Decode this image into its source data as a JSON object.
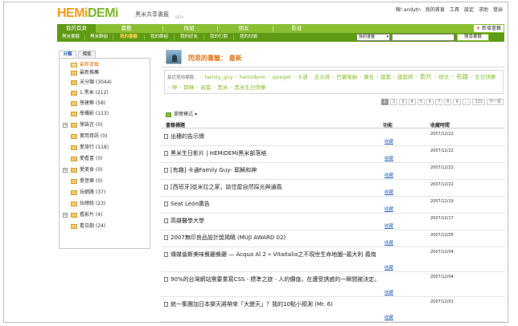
{
  "header": {
    "logo": "HEMiDEMi",
    "subtitle": "黑米共享書籤",
    "beta": "BETA",
    "user_links": [
      "嗨! andytn",
      "我的首頁",
      "工具",
      "設定",
      "求助",
      "登出"
    ]
  },
  "main_nav": {
    "tabs": [
      "我的首頁",
      "書籤",
      "群組",
      "朋友",
      "影音"
    ],
    "new_bookmark": "新增書籤"
  },
  "sub_nav": {
    "items": [
      "黑米書籤",
      "黑米群組",
      "我的書籤",
      "我的群組",
      "我的好友",
      "我的訂閱",
      "我的討論"
    ],
    "search_select": "我的書籤",
    "search_placeholder": "",
    "search_button": "搜尋書籤"
  },
  "sidebar": {
    "tabs": [
      "分類",
      "標籤"
    ],
    "items": [
      {
        "label": "最新書籤",
        "expander": false,
        "active": true
      },
      {
        "label": "最新推薦",
        "expander": false,
        "active": false
      },
      {
        "label": "未分類 (3044)",
        "expander": false,
        "active": false
      },
      {
        "label": "1.黑米 (212)",
        "expander": false,
        "active": false
      },
      {
        "label": "學建築 (58)",
        "expander": false,
        "active": false
      },
      {
        "label": "學攝影 (113)",
        "expander": false,
        "active": false
      },
      {
        "label": "學語言 (0)",
        "expander": true,
        "active": false
      },
      {
        "label": "實用資訊 (0)",
        "expander": false,
        "active": false
      },
      {
        "label": "愛旅行 (118)",
        "expander": false,
        "active": false
      },
      {
        "label": "愛看書 (0)",
        "expander": false,
        "active": false
      },
      {
        "label": "愛美食 (0)",
        "expander": true,
        "active": false
      },
      {
        "label": "愛音樂 (0)",
        "expander": false,
        "active": false
      },
      {
        "label": "玩網路 (37)",
        "expander": false,
        "active": false
      },
      {
        "label": "玩總統 (23)",
        "expander": false,
        "active": false
      },
      {
        "label": "看影片 (4)",
        "expander": true,
        "active": false
      },
      {
        "label": "看日劇 (24)",
        "expander": false,
        "active": false
      }
    ]
  },
  "content": {
    "title": "閃思的書籤： 最新",
    "tags_label": "最近使用標籤：",
    "tags": [
      {
        "text": "family_guy",
        "big": false
      },
      {
        "text": "hemidemi",
        "big": false
      },
      {
        "text": "spiegel",
        "big": false
      },
      {
        "text": "卡通",
        "big": false
      },
      {
        "text": "吉示排",
        "big": false
      },
      {
        "text": "巴塞隆納",
        "big": false
      },
      {
        "text": "廣告",
        "big": false
      },
      {
        "text": "建築",
        "big": false
      },
      {
        "text": "建築師",
        "big": false
      },
      {
        "text": "影片",
        "big": true
      },
      {
        "text": "德文",
        "big": false
      },
      {
        "text": "有趣",
        "big": true
      },
      {
        "text": "生日快樂",
        "big": false
      },
      {
        "text": "神",
        "big": false
      },
      {
        "text": "耶穌",
        "big": false
      },
      {
        "text": "高築",
        "big": false
      },
      {
        "text": "黑米",
        "big": false
      },
      {
        "text": "黑米生日快樂",
        "big": false
      }
    ],
    "pager": [
      "1",
      "2",
      "3",
      "4",
      "5",
      "6",
      "7",
      "8",
      "9",
      "...",
      "123",
      "下一頁"
    ],
    "pager_active": 0,
    "view_mode": "瀏覽模式",
    "columns": {
      "title": "書籤標題",
      "function": "功能",
      "date": "收藏時間"
    },
    "rows": [
      {
        "title": "出穗的告示牌",
        "func": "收藏",
        "date": "2007/12/22"
      },
      {
        "title": "黑米生日影片 | HEMiDEMi黑米部落格",
        "func": "收藏",
        "date": "2007/12/22"
      },
      {
        "title": "[有趣] 卡通Family Guy- 耶穌和神",
        "func": "收藏",
        "date": "2007/12/22"
      },
      {
        "title": "[西班牙]從米拉之家，談住屋自然採光與通風",
        "func": "收藏",
        "date": "2007/12/22"
      },
      {
        "title": "Seat León廣告",
        "func": "收藏",
        "date": "2007/12/19"
      },
      {
        "title": "高雄醫學大學",
        "func": "收藏",
        "date": "2007/12/17"
      },
      {
        "title": "2007無印良品設計獎揭曉 (MUJI AWARD 02)",
        "func": "收藏",
        "date": "2007/12/05"
      },
      {
        "title": "傳媒倫斯美味餐廳餐廳 — Acqua Al 2 « Vitaitalia之不現世生命地圖─義大利 義南",
        "func": "收藏",
        "date": "2007/12/04"
      },
      {
        "title": "90%的台灣網站需要重寫CSS - 標準之旅 - 人的價值，在遭受誘惑的一瞬間被決定。",
        "func": "收藏",
        "date": "2007/12/04"
      },
      {
        "title": "統一集團加日本樂天將帶來「大變天」？我的10點小預測 (Mr. 6)",
        "func": "收藏",
        "date": "2007/12/01"
      }
    ]
  }
}
